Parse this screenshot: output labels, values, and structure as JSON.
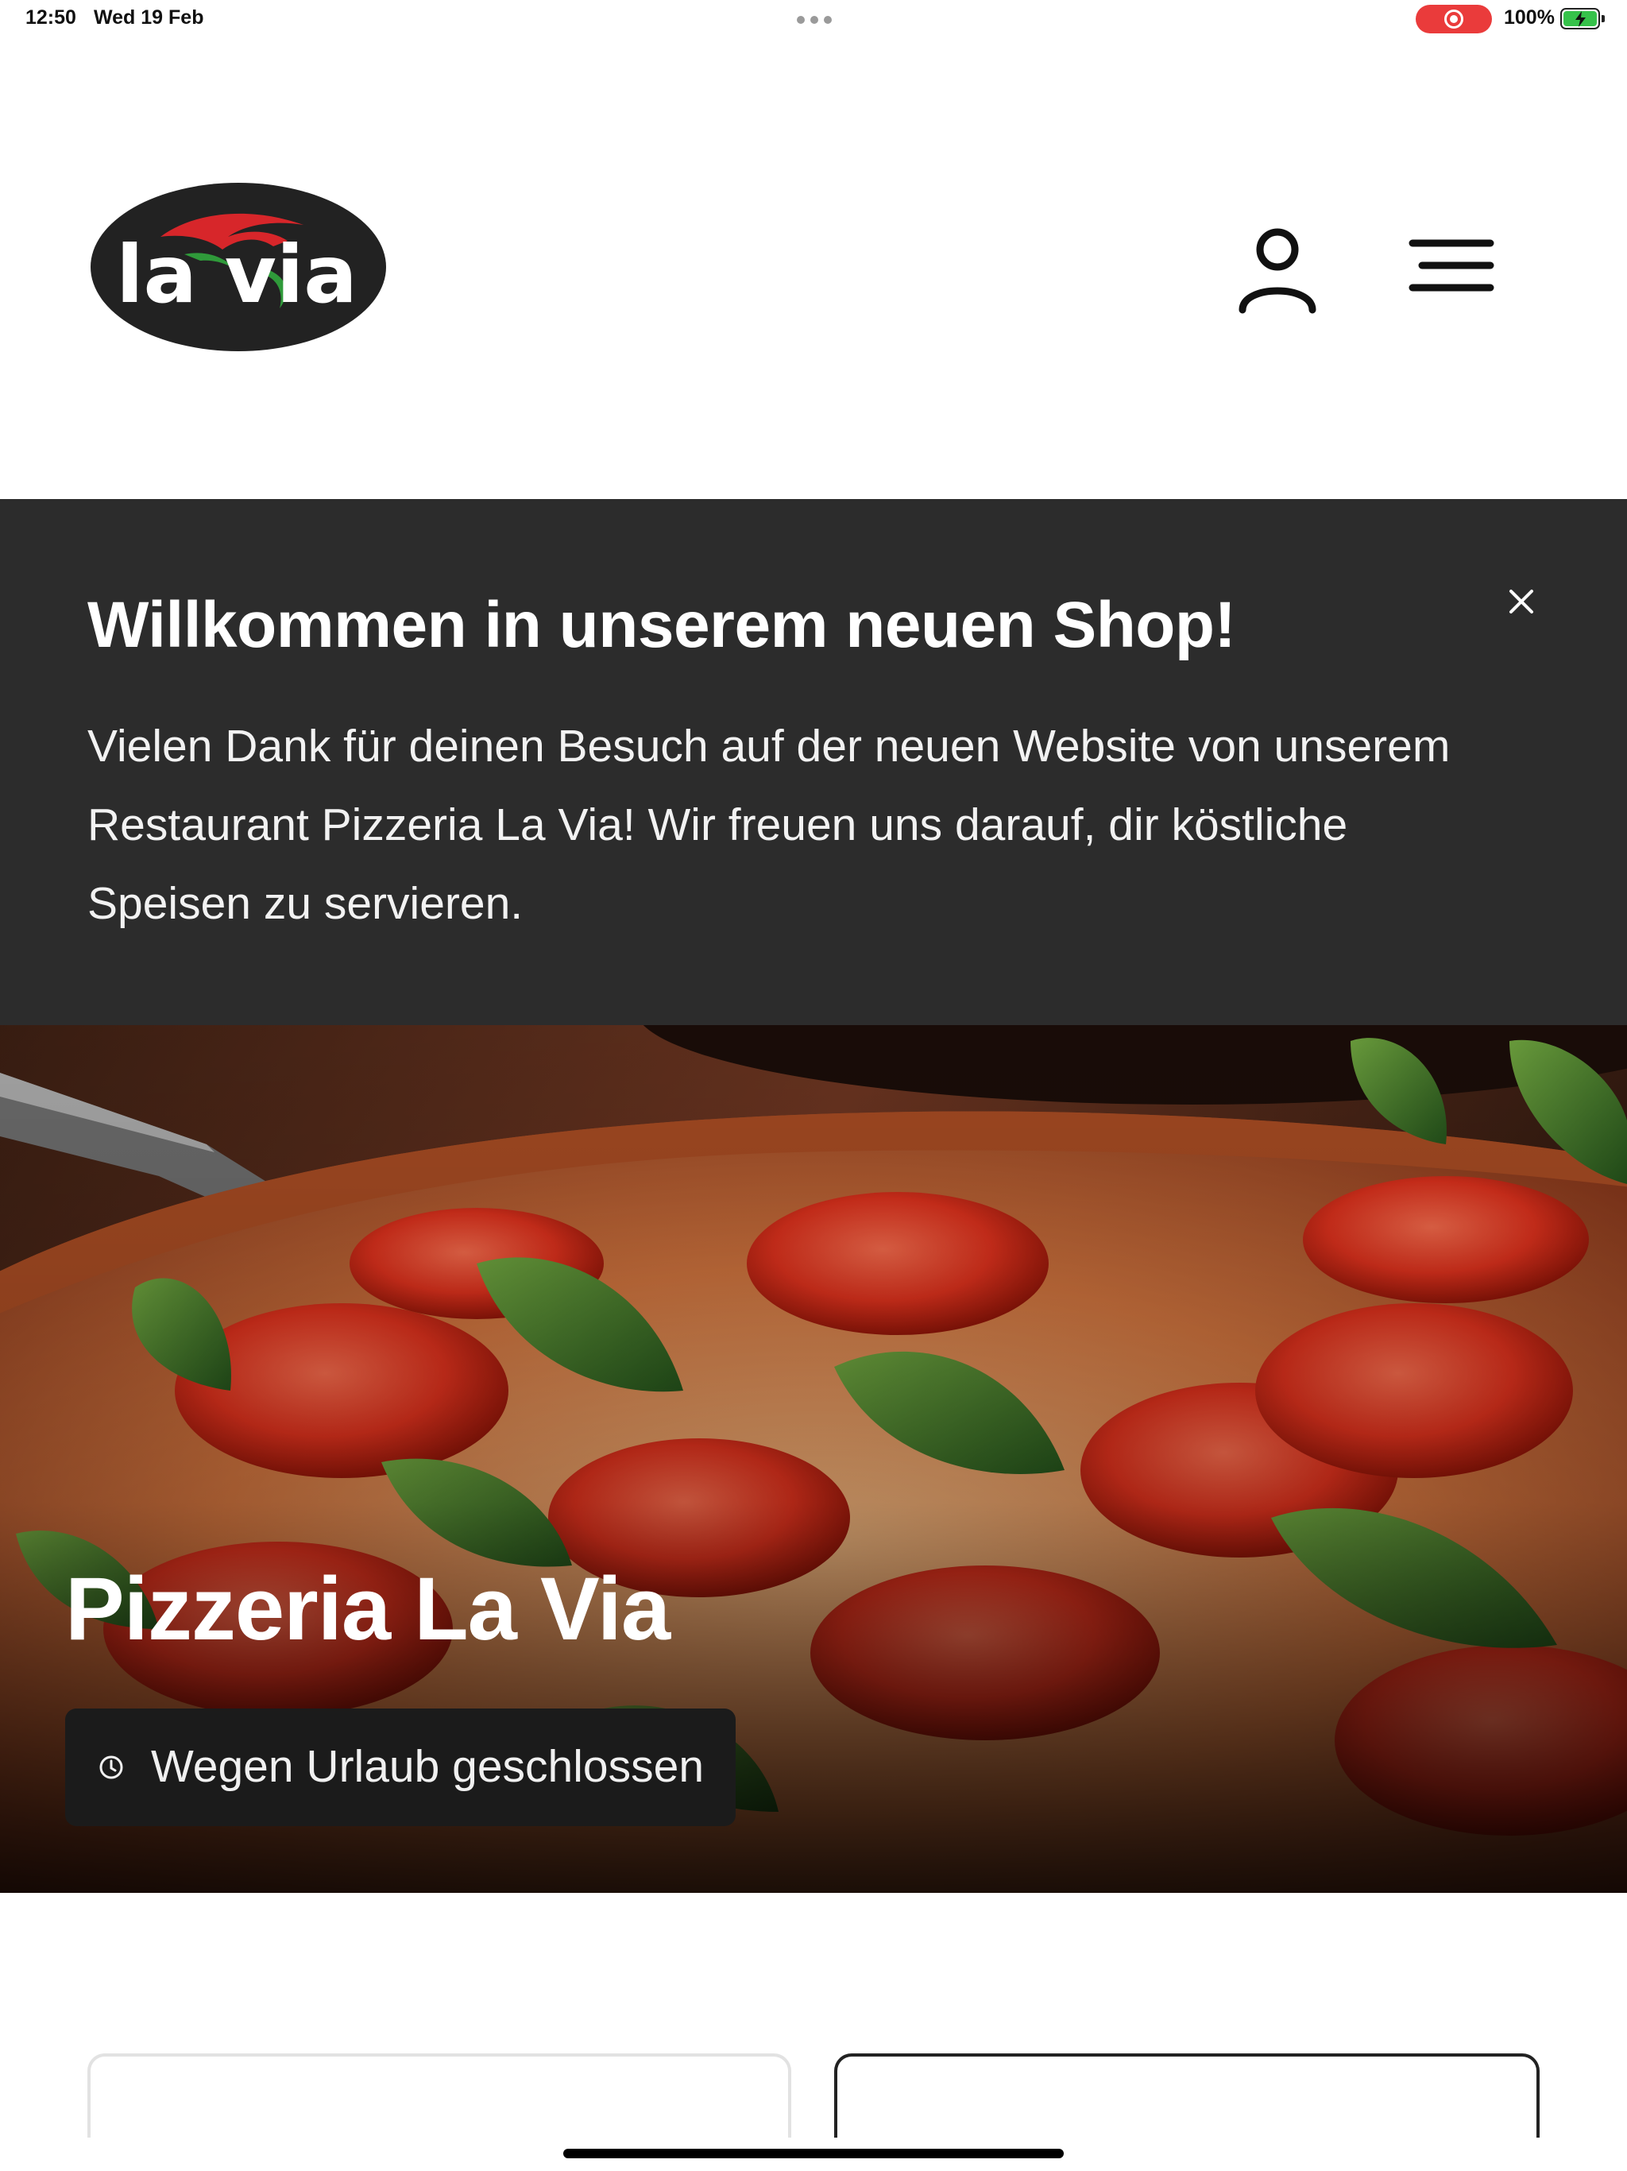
{
  "status_bar": {
    "time": "12:50",
    "date": "Wed 19 Feb",
    "battery_percent": "100%",
    "screen_recording": true,
    "battery_level": 1.0
  },
  "header": {
    "logo_text": "la via",
    "icons": [
      "user-icon",
      "menu-icon"
    ]
  },
  "banner": {
    "title": "Willkommen in unserem neuen Shop!",
    "text": "Vielen Dank für deinen Besuch auf der neuen Website von unserem Restaurant Pizzeria La Via! Wir freuen uns darauf, dir köstliche Speisen zu servieren.",
    "close_icon": "close-icon",
    "background_color": "#2c2c2c"
  },
  "hero": {
    "title": "Pizzeria La Via",
    "status_text": "Wegen Urlaub geschlossen",
    "status_icon": "clock-icon"
  },
  "colors": {
    "brand_red": "#d7262a",
    "brand_green": "#2f9a3a",
    "logo_dark": "#222222"
  }
}
